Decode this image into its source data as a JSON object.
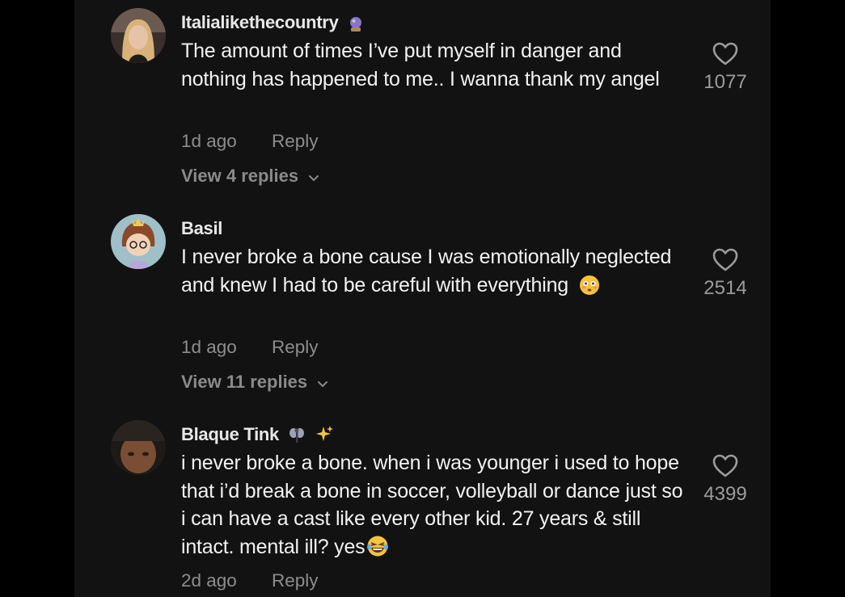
{
  "comments": [
    {
      "username": "Italialikethecountry",
      "text": "The amount of times I’ve put myself in danger and nothing has happened to me.. I wanna thank my angel",
      "time": "1d ago",
      "reply_label": "Reply",
      "view_replies": "View 4 replies",
      "likes": "1077",
      "name_badge_icon": "crystal-ball-icon"
    },
    {
      "username": "Basil",
      "text": "I never broke a bone cause I was emotionally neglected and knew I had to be careful with everything",
      "time": "1d ago",
      "reply_label": "Reply",
      "view_replies": "View 11 replies",
      "likes": "2514",
      "text_emoji_icon": "flushed-face-emoji"
    },
    {
      "username": "Blaque Tink",
      "text": "i never broke a bone. when i was younger i used to hope that i’d break a bone in soccer, volleyball or dance just so i can have a cast like every other kid. 27 years & still intact. mental ill? yes",
      "time": "2d ago",
      "reply_label": "Reply",
      "likes": "4399",
      "name_badge_icons": [
        "fairy-icon",
        "sparkles-icon"
      ],
      "text_emoji_icon": "laughing-tears-emoji"
    }
  ],
  "colors": {
    "background": "#000000",
    "panel": "#121212",
    "text": "#f2f2f2",
    "muted": "#8d8d8d"
  }
}
